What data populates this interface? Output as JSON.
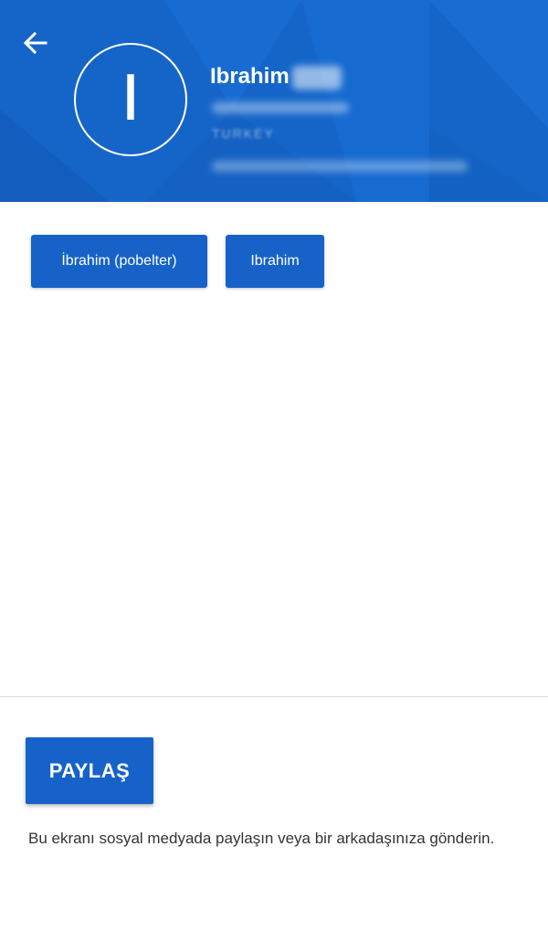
{
  "header": {
    "avatar_letter": "I",
    "name": "Ibrahim",
    "country": "TURKEY",
    "back_icon": "arrow-left-icon"
  },
  "accounts": [
    {
      "label": "İbrahim (pobelter)"
    },
    {
      "label": "Ibrahim"
    }
  ],
  "share": {
    "button_label": "PAYLAŞ",
    "description": "Bu ekranı sosyal medyada paylaşın veya bir arkadaşınıza gönderin."
  },
  "colors": {
    "header_bg": "#1565c9",
    "button_bg": "#1662c8",
    "text": "#333333"
  }
}
